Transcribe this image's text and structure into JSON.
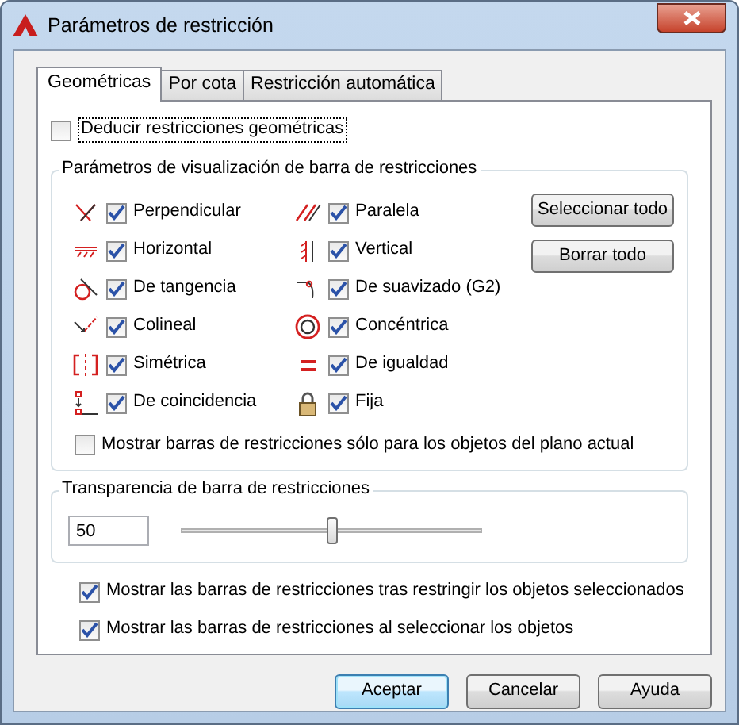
{
  "window": {
    "title": "Parámetros de restricción"
  },
  "tabs": [
    {
      "label": "Geométricas",
      "selected": true
    },
    {
      "label": "Por cota",
      "selected": false
    },
    {
      "label": "Restricción automática",
      "selected": false
    }
  ],
  "infer": {
    "label": "Deducir restricciones geométricas",
    "checked": false
  },
  "display_group": {
    "title": "Parámetros de visualización de barra de restricciones",
    "constraints": [
      {
        "label": "Perpendicular",
        "checked": true
      },
      {
        "label": "Paralela",
        "checked": true
      },
      {
        "label": "Horizontal",
        "checked": true
      },
      {
        "label": "Vertical",
        "checked": true
      },
      {
        "label": "De tangencia",
        "checked": true
      },
      {
        "label": "De suavizado (G2)",
        "checked": true
      },
      {
        "label": "Colineal",
        "checked": true
      },
      {
        "label": "Concéntrica",
        "checked": true
      },
      {
        "label": "Simétrica",
        "checked": true
      },
      {
        "label": "De igualdad",
        "checked": true
      },
      {
        "label": "De coincidencia",
        "checked": true
      },
      {
        "label": "Fija",
        "checked": true
      }
    ],
    "buttons": [
      "Seleccionar todo",
      "Borrar todo"
    ],
    "current_plane": {
      "label": "Mostrar barras de restricciones sólo para los objetos del plano actual",
      "checked": false
    }
  },
  "transparency": {
    "title": "Transparencia de barra de restricciones",
    "value": "50",
    "level": 0.5
  },
  "options": [
    {
      "label": "Mostrar las barras de restricciones tras restringir los objetos seleccionados",
      "checked": true
    },
    {
      "label": "Mostrar las barras de restricciones al seleccionar los objetos",
      "checked": true
    }
  ],
  "buttons": [
    {
      "label": "Aceptar",
      "default": true
    },
    {
      "label": "Cancelar",
      "default": false
    },
    {
      "label": "Ayuda",
      "default": false
    }
  ]
}
